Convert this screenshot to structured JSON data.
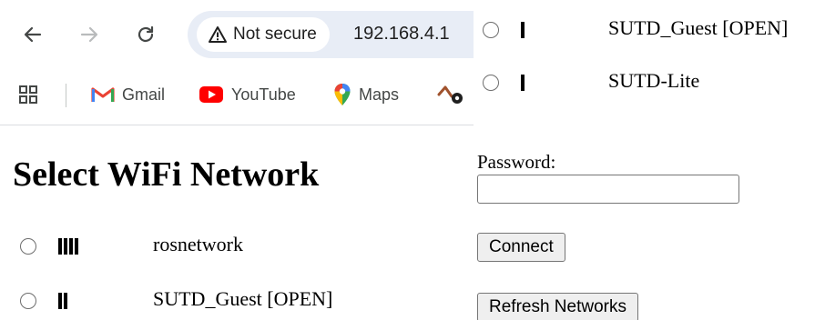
{
  "browser": {
    "security_label": "Not secure",
    "url": "192.168.4.1",
    "bookmarks": [
      {
        "label": "Gmail",
        "icon": "gmail-icon"
      },
      {
        "label": "YouTube",
        "icon": "youtube-icon"
      },
      {
        "label": "Maps",
        "icon": "maps-icon"
      }
    ]
  },
  "page": {
    "title": "Select WiFi Network",
    "networks": [
      {
        "ssid": "rosnetwork",
        "signal_bars": 4
      },
      {
        "ssid": "SUTD_Guest [OPEN]",
        "signal_bars": 2
      },
      {
        "ssid": "SUTD_Guest [OPEN]",
        "signal_bars": 1
      },
      {
        "ssid": "SUTD-Lite",
        "signal_bars": 1
      }
    ],
    "password_label": "Password:",
    "password_value": "",
    "connect_label": "Connect",
    "refresh_label": "Refresh Networks"
  },
  "colors": {
    "omnibox_bg": "#e8edf6",
    "gmail_red": "#ea4335",
    "youtube_red": "#ff0000",
    "button_bg": "#efefef"
  }
}
